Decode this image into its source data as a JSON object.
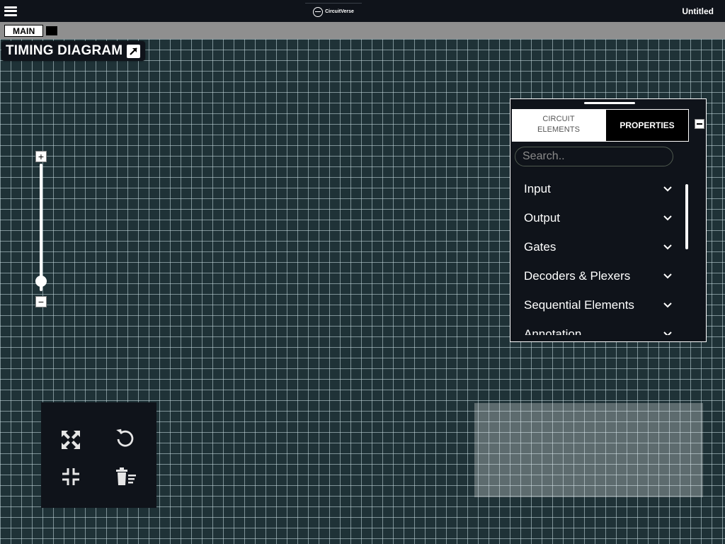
{
  "navbar": {
    "logo_text": "CircuitVerse",
    "project_title": "Untitled"
  },
  "tabs": {
    "main_label": "MAIN"
  },
  "timing_diagram": {
    "label": "TIMING DIAGRAM"
  },
  "zoom": {
    "plus": "+",
    "minus": "−",
    "level": 0.1
  },
  "tools": {
    "icons": [
      "fit-to-screen-icon",
      "undo-icon",
      "exit-fullscreen-icon",
      "clear-all-icon"
    ]
  },
  "panel": {
    "tab_circuit_elements": "CIRCUIT ELEMENTS",
    "tab_circuit_line1": "CIRCUIT",
    "tab_circuit_line2": "ELEMENTS",
    "tab_properties": "PROPERTIES",
    "search_placeholder": "Search..",
    "categories": [
      "Input",
      "Output",
      "Gates",
      "Decoders & Plexers",
      "Sequential Elements",
      "Annotation"
    ]
  },
  "colors": {
    "canvas": "#1f3237",
    "grid": "#cde1e6",
    "panel_bg": "#0f131a",
    "tabbar": "#8f8f8f"
  }
}
